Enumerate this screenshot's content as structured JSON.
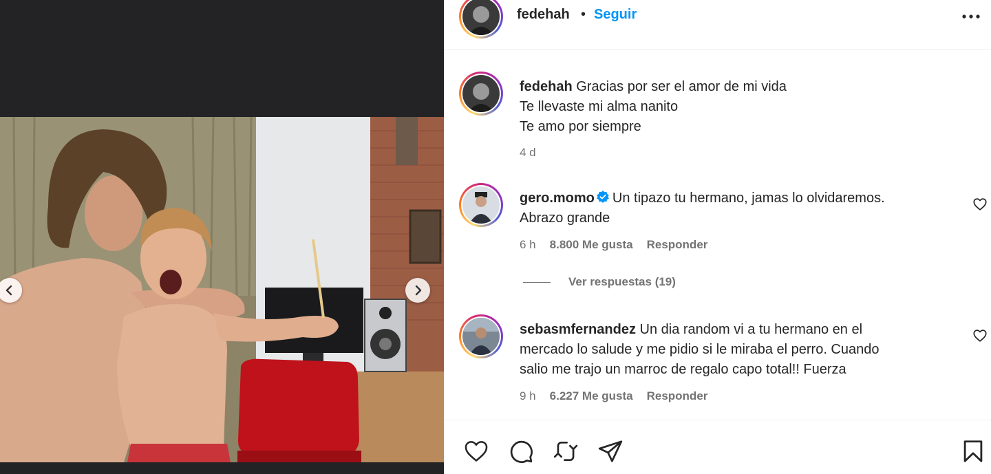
{
  "post": {
    "username": "fedehah",
    "separator": "•",
    "follow_label": "Seguir",
    "more_icon": "more-horizontal-icon"
  },
  "caption": {
    "username": "fedehah",
    "line1": "Gracias por ser el amor de mi vida",
    "line2": "Te llevaste mi alma nanito",
    "line3": "Te amo por siempre",
    "time": "4 d"
  },
  "comments": [
    {
      "username": "gero.momo",
      "verified": true,
      "line1": "Un tipazo tu hermano, jamas lo olvidaremos.",
      "line2": "Abrazo grande",
      "time": "6 h",
      "likes": "8.800 Me gusta",
      "reply_label": "Responder"
    },
    {
      "username": "sebasmfernandez",
      "verified": false,
      "line1": "Un dia random vi a tu hermano en el",
      "line2": "mercado lo salude y me pidio si le miraba el perro. Cuando",
      "line3": "salio me trajo un marroc de regalo capo total!! Fuerza",
      "time": "9 h",
      "likes": "6.227 Me gusta",
      "reply_label": "Responder"
    }
  ],
  "view_replies": "Ver respuestas (19)",
  "colors": {
    "link_blue": "#0095f6",
    "muted": "#737373",
    "text": "#262626",
    "media_bg": "#232326"
  },
  "icons": [
    "heart-icon",
    "comment-icon",
    "share-icon",
    "repost-icon",
    "bookmark-icon",
    "chevron-left-icon",
    "chevron-right-icon",
    "verified-badge-icon"
  ]
}
